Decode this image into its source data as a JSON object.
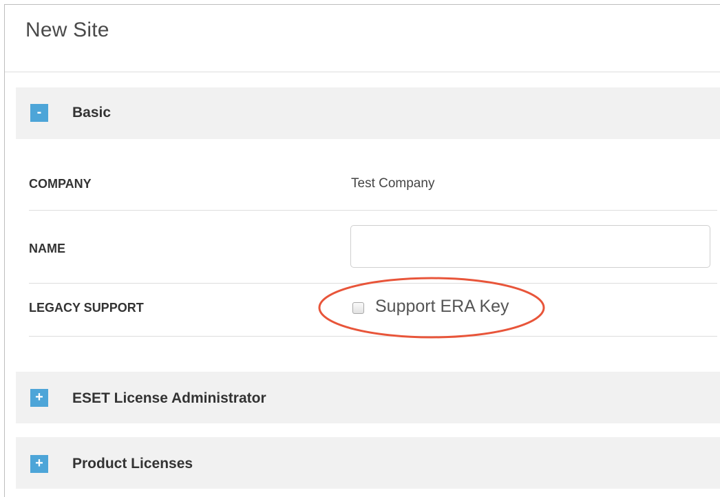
{
  "page": {
    "title": "New Site"
  },
  "sections": {
    "basic": {
      "toggle": "-",
      "title": "Basic",
      "fields": {
        "company": {
          "label": "COMPANY",
          "value": "Test Company"
        },
        "name": {
          "label": "NAME",
          "value": "",
          "placeholder": ""
        },
        "legacy_support": {
          "label": "LEGACY SUPPORT",
          "checkbox_label": "Support ERA Key",
          "checked": false
        }
      }
    },
    "eset_license_administrator": {
      "toggle": "+",
      "title": "ESET License Administrator"
    },
    "product_licenses": {
      "toggle": "+",
      "title": "Product Licenses"
    }
  },
  "annotation": {
    "highlight_color": "#e8553a"
  },
  "colors": {
    "accent": "#4da5d8",
    "section_bg": "#f1f1f1"
  }
}
